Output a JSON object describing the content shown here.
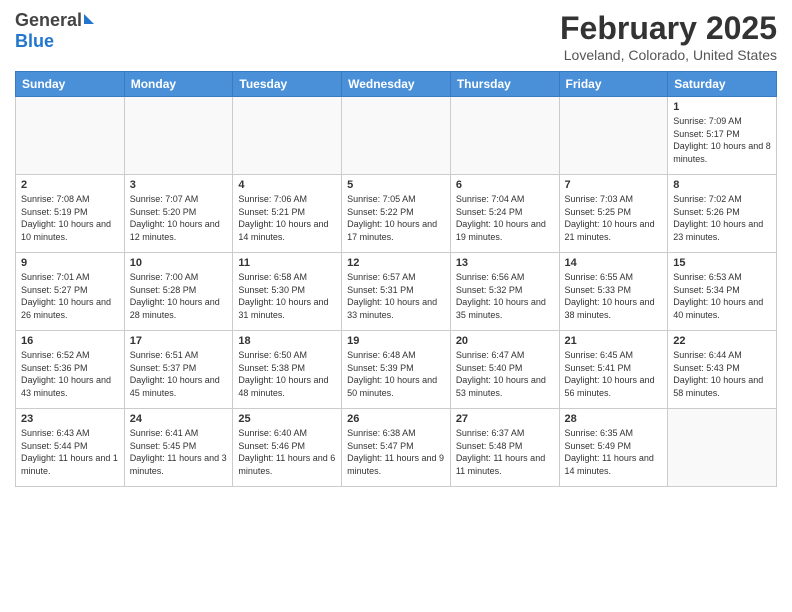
{
  "header": {
    "logo_general": "General",
    "logo_blue": "Blue",
    "main_title": "February 2025",
    "subtitle": "Loveland, Colorado, United States"
  },
  "days_of_week": [
    "Sunday",
    "Monday",
    "Tuesday",
    "Wednesday",
    "Thursday",
    "Friday",
    "Saturday"
  ],
  "weeks": [
    [
      {
        "day": "",
        "info": ""
      },
      {
        "day": "",
        "info": ""
      },
      {
        "day": "",
        "info": ""
      },
      {
        "day": "",
        "info": ""
      },
      {
        "day": "",
        "info": ""
      },
      {
        "day": "",
        "info": ""
      },
      {
        "day": "1",
        "info": "Sunrise: 7:09 AM\nSunset: 5:17 PM\nDaylight: 10 hours\nand 8 minutes."
      }
    ],
    [
      {
        "day": "2",
        "info": "Sunrise: 7:08 AM\nSunset: 5:19 PM\nDaylight: 10 hours\nand 10 minutes."
      },
      {
        "day": "3",
        "info": "Sunrise: 7:07 AM\nSunset: 5:20 PM\nDaylight: 10 hours\nand 12 minutes."
      },
      {
        "day": "4",
        "info": "Sunrise: 7:06 AM\nSunset: 5:21 PM\nDaylight: 10 hours\nand 14 minutes."
      },
      {
        "day": "5",
        "info": "Sunrise: 7:05 AM\nSunset: 5:22 PM\nDaylight: 10 hours\nand 17 minutes."
      },
      {
        "day": "6",
        "info": "Sunrise: 7:04 AM\nSunset: 5:24 PM\nDaylight: 10 hours\nand 19 minutes."
      },
      {
        "day": "7",
        "info": "Sunrise: 7:03 AM\nSunset: 5:25 PM\nDaylight: 10 hours\nand 21 minutes."
      },
      {
        "day": "8",
        "info": "Sunrise: 7:02 AM\nSunset: 5:26 PM\nDaylight: 10 hours\nand 23 minutes."
      }
    ],
    [
      {
        "day": "9",
        "info": "Sunrise: 7:01 AM\nSunset: 5:27 PM\nDaylight: 10 hours\nand 26 minutes."
      },
      {
        "day": "10",
        "info": "Sunrise: 7:00 AM\nSunset: 5:28 PM\nDaylight: 10 hours\nand 28 minutes."
      },
      {
        "day": "11",
        "info": "Sunrise: 6:58 AM\nSunset: 5:30 PM\nDaylight: 10 hours\nand 31 minutes."
      },
      {
        "day": "12",
        "info": "Sunrise: 6:57 AM\nSunset: 5:31 PM\nDaylight: 10 hours\nand 33 minutes."
      },
      {
        "day": "13",
        "info": "Sunrise: 6:56 AM\nSunset: 5:32 PM\nDaylight: 10 hours\nand 35 minutes."
      },
      {
        "day": "14",
        "info": "Sunrise: 6:55 AM\nSunset: 5:33 PM\nDaylight: 10 hours\nand 38 minutes."
      },
      {
        "day": "15",
        "info": "Sunrise: 6:53 AM\nSunset: 5:34 PM\nDaylight: 10 hours\nand 40 minutes."
      }
    ],
    [
      {
        "day": "16",
        "info": "Sunrise: 6:52 AM\nSunset: 5:36 PM\nDaylight: 10 hours\nand 43 minutes."
      },
      {
        "day": "17",
        "info": "Sunrise: 6:51 AM\nSunset: 5:37 PM\nDaylight: 10 hours\nand 45 minutes."
      },
      {
        "day": "18",
        "info": "Sunrise: 6:50 AM\nSunset: 5:38 PM\nDaylight: 10 hours\nand 48 minutes."
      },
      {
        "day": "19",
        "info": "Sunrise: 6:48 AM\nSunset: 5:39 PM\nDaylight: 10 hours\nand 50 minutes."
      },
      {
        "day": "20",
        "info": "Sunrise: 6:47 AM\nSunset: 5:40 PM\nDaylight: 10 hours\nand 53 minutes."
      },
      {
        "day": "21",
        "info": "Sunrise: 6:45 AM\nSunset: 5:41 PM\nDaylight: 10 hours\nand 56 minutes."
      },
      {
        "day": "22",
        "info": "Sunrise: 6:44 AM\nSunset: 5:43 PM\nDaylight: 10 hours\nand 58 minutes."
      }
    ],
    [
      {
        "day": "23",
        "info": "Sunrise: 6:43 AM\nSunset: 5:44 PM\nDaylight: 11 hours\nand 1 minute."
      },
      {
        "day": "24",
        "info": "Sunrise: 6:41 AM\nSunset: 5:45 PM\nDaylight: 11 hours\nand 3 minutes."
      },
      {
        "day": "25",
        "info": "Sunrise: 6:40 AM\nSunset: 5:46 PM\nDaylight: 11 hours\nand 6 minutes."
      },
      {
        "day": "26",
        "info": "Sunrise: 6:38 AM\nSunset: 5:47 PM\nDaylight: 11 hours\nand 9 minutes."
      },
      {
        "day": "27",
        "info": "Sunrise: 6:37 AM\nSunset: 5:48 PM\nDaylight: 11 hours\nand 11 minutes."
      },
      {
        "day": "28",
        "info": "Sunrise: 6:35 AM\nSunset: 5:49 PM\nDaylight: 11 hours\nand 14 minutes."
      },
      {
        "day": "",
        "info": ""
      }
    ]
  ]
}
